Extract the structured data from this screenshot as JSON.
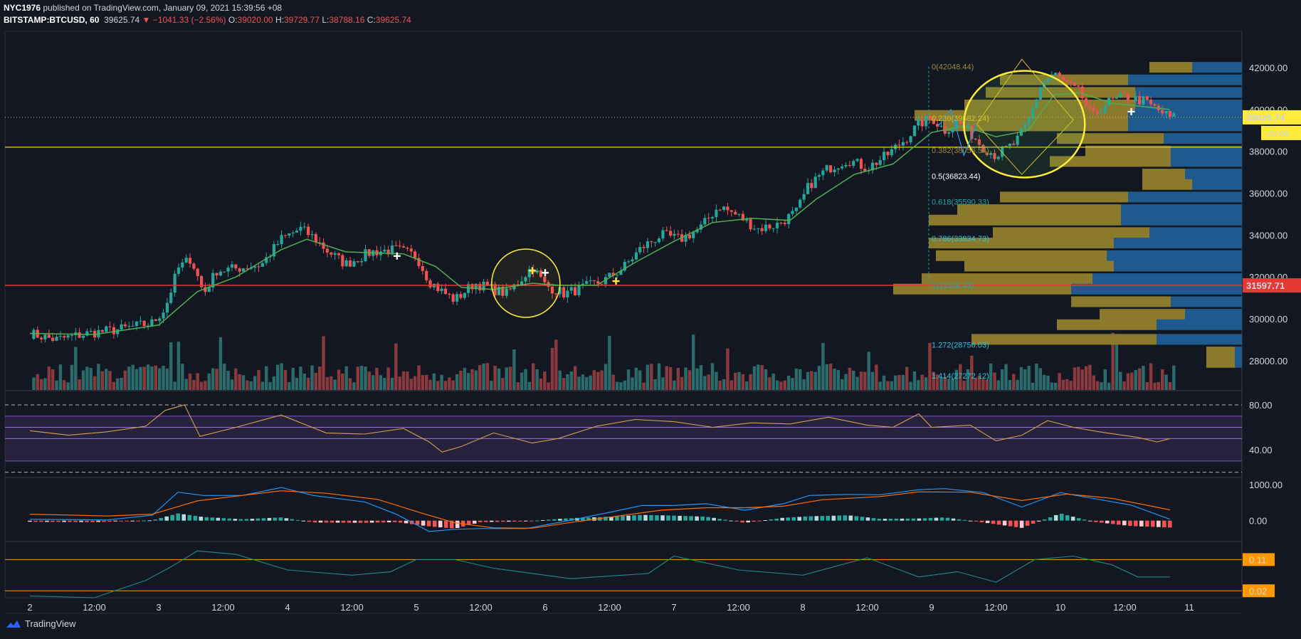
{
  "header": {
    "author": "NYC1976",
    "published_text": "published on TradingView.com, January 09, 2021 15:39:56 +08",
    "symbol": "BITSTAMP:BTCUSD, 60",
    "last_price": "39625.74",
    "change": "−1041.33 (−2.56%)",
    "open_label": "O:",
    "open": "39020.00",
    "high_label": "H:",
    "high": "39729.77",
    "low_label": "L:",
    "low": "38788.16",
    "close_label": "C:",
    "close": "39625.74"
  },
  "footer": {
    "brand": "TradingView"
  },
  "colors": {
    "background": "#131722",
    "up": "#26a69a",
    "down": "#ef5350",
    "volume_up": "#2b6b6b",
    "volume_down": "#8a3a3d",
    "ema": "#4caf50",
    "support": "#e53935",
    "resistance": "#d4c22c",
    "rsi": "#d4a04a",
    "macd": "#2196f3",
    "signal": "#ff6d00",
    "vp_left": "#8b7a2c",
    "vp_right": "#1e5a8e",
    "adx": "#1f8a8a"
  },
  "chart_data": [
    {
      "type": "candlestick",
      "symbol": "BITSTAMP:BTCUSD",
      "timeframe": "60",
      "x_tick_labels": [
        "2",
        "12:00",
        "3",
        "12:00",
        "4",
        "12:00",
        "5",
        "12:00",
        "6",
        "12:00",
        "7",
        "12:00",
        "8",
        "12:00",
        "9",
        "12:00",
        "10",
        "12:00",
        "11"
      ],
      "y_tick_labels": [
        "42000.00",
        "40000.00",
        "38000.00",
        "36000.00",
        "34000.00",
        "32000.00",
        "30000.00",
        "28000.00"
      ],
      "ylim": [
        26600,
        43600
      ],
      "close_path": [
        [
          2.0,
          29300
        ],
        [
          2.2,
          29000
        ],
        [
          2.45,
          29300
        ],
        [
          2.7,
          29500
        ],
        [
          2.95,
          29800
        ],
        [
          3.05,
          30500
        ],
        [
          3.15,
          32400
        ],
        [
          3.25,
          32900
        ],
        [
          3.35,
          31200
        ],
        [
          3.45,
          32300
        ],
        [
          3.6,
          32400
        ],
        [
          3.8,
          32600
        ],
        [
          3.95,
          33800
        ],
        [
          4.1,
          34300
        ],
        [
          4.2,
          33900
        ],
        [
          4.3,
          33300
        ],
        [
          4.45,
          32600
        ],
        [
          4.65,
          33200
        ],
        [
          4.85,
          33300
        ],
        [
          5.0,
          33000
        ],
        [
          5.1,
          31800
        ],
        [
          5.2,
          31300
        ],
        [
          5.3,
          30900
        ],
        [
          5.45,
          31700
        ],
        [
          5.6,
          31400
        ],
        [
          5.7,
          31200
        ],
        [
          5.8,
          31800
        ],
        [
          5.9,
          32500
        ],
        [
          6.0,
          31600
        ],
        [
          6.15,
          31200
        ],
        [
          6.3,
          31500
        ],
        [
          6.45,
          31800
        ],
        [
          6.6,
          32400
        ],
        [
          6.75,
          33400
        ],
        [
          6.9,
          34000
        ],
        [
          7.05,
          33800
        ],
        [
          7.2,
          34300
        ],
        [
          7.35,
          35400
        ],
        [
          7.5,
          34900
        ],
        [
          7.65,
          34300
        ],
        [
          7.8,
          34500
        ],
        [
          7.95,
          35100
        ],
        [
          8.05,
          36400
        ],
        [
          8.2,
          37200
        ],
        [
          8.35,
          37600
        ],
        [
          8.5,
          37200
        ],
        [
          8.65,
          37800
        ],
        [
          8.8,
          38600
        ],
        [
          8.9,
          39300
        ],
        [
          9.0,
          39600
        ],
        [
          9.1,
          39000
        ],
        [
          9.2,
          39400
        ],
        [
          9.3,
          38900
        ],
        [
          9.4,
          38200
        ],
        [
          9.5,
          37800
        ],
        [
          9.65,
          38400
        ],
        [
          9.75,
          39400
        ],
        [
          9.85,
          41200
        ],
        [
          9.95,
          41700
        ],
        [
          10.05,
          41200
        ],
        [
          10.15,
          40800
        ],
        [
          10.25,
          39600
        ],
        [
          10.35,
          40300
        ],
        [
          10.5,
          40600
        ],
        [
          10.65,
          40400
        ],
        [
          10.75,
          40000
        ],
        [
          10.85,
          39626
        ]
      ],
      "ema_path": [
        [
          2.0,
          29300
        ],
        [
          2.5,
          29250
        ],
        [
          3.0,
          29700
        ],
        [
          3.3,
          31300
        ],
        [
          3.6,
          32000
        ],
        [
          3.95,
          33300
        ],
        [
          4.15,
          33800
        ],
        [
          4.45,
          33200
        ],
        [
          4.9,
          33100
        ],
        [
          5.15,
          32500
        ],
        [
          5.35,
          31500
        ],
        [
          5.6,
          31400
        ],
        [
          5.9,
          31700
        ],
        [
          6.1,
          31600
        ],
        [
          6.4,
          31600
        ],
        [
          6.7,
          32700
        ],
        [
          7.0,
          33700
        ],
        [
          7.3,
          34600
        ],
        [
          7.6,
          34800
        ],
        [
          7.9,
          34700
        ],
        [
          8.1,
          35700
        ],
        [
          8.4,
          36900
        ],
        [
          8.7,
          37400
        ],
        [
          9.0,
          38900
        ],
        [
          9.25,
          39200
        ],
        [
          9.5,
          38700
        ],
        [
          9.75,
          39000
        ],
        [
          9.95,
          40700
        ],
        [
          10.15,
          40800
        ],
        [
          10.4,
          40300
        ],
        [
          10.85,
          40000
        ]
      ],
      "horizontal_lines": [
        {
          "name": "support",
          "price": 31597.71,
          "label": "31597.71",
          "color": "#e53935"
        },
        {
          "name": "resistance",
          "price": 38200,
          "color": "#d4c22c"
        },
        {
          "name": "last-price",
          "price": 39625.74,
          "label": "39625.74",
          "countdown": "20:06",
          "color": "#d4c22c"
        }
      ],
      "fib_levels": [
        {
          "ratio": "0",
          "price": 42048.44,
          "label": "0(42048.44)",
          "color": "#9a8a3c"
        },
        {
          "ratio": "0.236",
          "price": 39582.24,
          "label": "0.236(39582.24)",
          "color": "#d4c22c"
        },
        {
          "ratio": "0.382",
          "price": 38056.54,
          "label": "0.382(38056.54)",
          "color": "#9a8a3c"
        },
        {
          "ratio": "0.5",
          "price": 36823.44,
          "label": "0.5(36823.44)",
          "color": "#ffffff"
        },
        {
          "ratio": "0.618",
          "price": 35590.33,
          "label": "0.618(35590.33)",
          "color": "#26a6a6"
        },
        {
          "ratio": "0.786",
          "price": 33834.73,
          "label": "0.786(33834.73)",
          "color": "#26c6da"
        },
        {
          "ratio": "1",
          "price": 31598.43,
          "label": "1(31598.43)",
          "color": "#26a6a6"
        },
        {
          "ratio": "1.272",
          "price": 28756.03,
          "label": "1.272(28756.03)",
          "color": "#26c6da"
        },
        {
          "ratio": "1.414",
          "price": 27272.12,
          "label": "1.414(27272.12)",
          "color": "#26c6da"
        }
      ],
      "volume_profile": [
        {
          "price": 42000,
          "left": 60,
          "right": 70
        },
        {
          "price": 41400,
          "left": 180,
          "right": 160
        },
        {
          "price": 40800,
          "left": 210,
          "right": 150
        },
        {
          "price": 40200,
          "left": 240,
          "right": 150
        },
        {
          "price": 39700,
          "left": 300,
          "right": 160
        },
        {
          "price": 39200,
          "left": 260,
          "right": 160
        },
        {
          "price": 38600,
          "left": 150,
          "right": 110
        },
        {
          "price": 38000,
          "left": 120,
          "right": 100
        },
        {
          "price": 37500,
          "left": 170,
          "right": 100
        },
        {
          "price": 36900,
          "left": 60,
          "right": 80
        },
        {
          "price": 36400,
          "left": 70,
          "right": 70
        },
        {
          "price": 35800,
          "left": 180,
          "right": 160
        },
        {
          "price": 35200,
          "left": 230,
          "right": 170
        },
        {
          "price": 34700,
          "left": 270,
          "right": 170
        },
        {
          "price": 34100,
          "left": 220,
          "right": 130
        },
        {
          "price": 33600,
          "left": 260,
          "right": 180
        },
        {
          "price": 33000,
          "left": 240,
          "right": 190
        },
        {
          "price": 32500,
          "left": 210,
          "right": 180
        },
        {
          "price": 31900,
          "left": 240,
          "right": 210
        },
        {
          "price": 31400,
          "left": 250,
          "right": 240
        },
        {
          "price": 30800,
          "left": 140,
          "right": 100
        },
        {
          "price": 30200,
          "left": 120,
          "right": 80
        },
        {
          "price": 29700,
          "left": 140,
          "right": 120
        },
        {
          "price": 29000,
          "left": 260,
          "right": 120
        },
        {
          "price": 28400,
          "left": 40,
          "right": 10
        },
        {
          "price": 27900,
          "left": 40,
          "right": 10
        }
      ]
    },
    {
      "type": "line",
      "name": "RSI",
      "y_tick_labels": [
        "80.00",
        "40.00"
      ],
      "ylim": [
        16,
        92
      ],
      "bands": [
        80,
        70,
        60,
        50,
        30,
        20
      ],
      "points": [
        [
          2.0,
          57
        ],
        [
          2.3,
          53
        ],
        [
          2.6,
          56
        ],
        [
          2.9,
          61
        ],
        [
          3.05,
          75
        ],
        [
          3.2,
          80
        ],
        [
          3.32,
          52
        ],
        [
          3.6,
          60
        ],
        [
          3.95,
          71
        ],
        [
          4.3,
          55
        ],
        [
          4.6,
          54
        ],
        [
          4.9,
          59
        ],
        [
          5.1,
          47
        ],
        [
          5.2,
          38
        ],
        [
          5.35,
          43
        ],
        [
          5.6,
          55
        ],
        [
          5.9,
          46
        ],
        [
          6.1,
          50
        ],
        [
          6.4,
          61
        ],
        [
          6.7,
          67
        ],
        [
          7.0,
          65
        ],
        [
          7.3,
          60
        ],
        [
          7.6,
          64
        ],
        [
          7.9,
          63
        ],
        [
          8.2,
          69
        ],
        [
          8.5,
          62
        ],
        [
          8.7,
          60
        ],
        [
          8.9,
          72
        ],
        [
          9.0,
          60
        ],
        [
          9.3,
          62
        ],
        [
          9.5,
          48
        ],
        [
          9.7,
          53
        ],
        [
          9.9,
          66
        ],
        [
          10.1,
          60
        ],
        [
          10.3,
          56
        ],
        [
          10.6,
          51
        ],
        [
          10.75,
          47
        ],
        [
          10.85,
          50
        ]
      ]
    },
    {
      "type": "bar",
      "name": "MACD",
      "y_tick_labels": [
        "1000.00",
        "0.00"
      ],
      "ylim": [
        -560,
        1180
      ],
      "macd_line": [
        [
          2.0,
          40
        ],
        [
          2.6,
          20
        ],
        [
          2.95,
          150
        ],
        [
          3.15,
          790
        ],
        [
          3.35,
          700
        ],
        [
          3.65,
          700
        ],
        [
          3.95,
          920
        ],
        [
          4.2,
          700
        ],
        [
          4.6,
          520
        ],
        [
          4.85,
          170
        ],
        [
          5.1,
          -300
        ],
        [
          5.3,
          -240
        ],
        [
          5.5,
          -220
        ],
        [
          5.85,
          -220
        ],
        [
          6.15,
          -20
        ],
        [
          6.5,
          230
        ],
        [
          6.75,
          420
        ],
        [
          7.0,
          420
        ],
        [
          7.25,
          470
        ],
        [
          7.55,
          290
        ],
        [
          7.85,
          470
        ],
        [
          8.05,
          700
        ],
        [
          8.35,
          730
        ],
        [
          8.6,
          720
        ],
        [
          8.9,
          860
        ],
        [
          9.1,
          890
        ],
        [
          9.4,
          780
        ],
        [
          9.7,
          380
        ],
        [
          10.0,
          780
        ],
        [
          10.25,
          620
        ],
        [
          10.55,
          430
        ],
        [
          10.85,
          40
        ]
      ],
      "signal_line": [
        [
          2.0,
          180
        ],
        [
          2.6,
          130
        ],
        [
          2.95,
          180
        ],
        [
          3.3,
          550
        ],
        [
          3.6,
          680
        ],
        [
          3.95,
          830
        ],
        [
          4.3,
          760
        ],
        [
          4.7,
          590
        ],
        [
          5.05,
          200
        ],
        [
          5.3,
          -60
        ],
        [
          5.6,
          -200
        ],
        [
          5.9,
          -210
        ],
        [
          6.2,
          -50
        ],
        [
          6.55,
          120
        ],
        [
          6.9,
          290
        ],
        [
          7.25,
          360
        ],
        [
          7.55,
          360
        ],
        [
          7.85,
          400
        ],
        [
          8.15,
          580
        ],
        [
          8.6,
          670
        ],
        [
          8.9,
          800
        ],
        [
          9.3,
          790
        ],
        [
          9.7,
          560
        ],
        [
          10.05,
          740
        ],
        [
          10.4,
          620
        ],
        [
          10.85,
          300
        ]
      ],
      "histogram": [
        [
          2.0,
          -30
        ],
        [
          2.5,
          -40
        ],
        [
          2.95,
          10
        ],
        [
          3.15,
          200
        ],
        [
          3.35,
          100
        ],
        [
          3.65,
          40
        ],
        [
          3.95,
          90
        ],
        [
          4.2,
          -50
        ],
        [
          4.6,
          -60
        ],
        [
          4.85,
          -40
        ],
        [
          5.1,
          -160
        ],
        [
          5.3,
          -220
        ],
        [
          5.5,
          -40
        ],
        [
          5.85,
          -20
        ],
        [
          6.15,
          60
        ],
        [
          6.5,
          110
        ],
        [
          6.75,
          160
        ],
        [
          7.0,
          140
        ],
        [
          7.25,
          110
        ],
        [
          7.55,
          -60
        ],
        [
          7.85,
          80
        ],
        [
          8.05,
          120
        ],
        [
          8.35,
          150
        ],
        [
          8.6,
          50
        ],
        [
          8.9,
          60
        ],
        [
          9.1,
          90
        ],
        [
          9.4,
          -50
        ],
        [
          9.7,
          -200
        ],
        [
          10.0,
          200
        ],
        [
          10.25,
          -30
        ],
        [
          10.55,
          -150
        ],
        [
          10.85,
          -190
        ]
      ]
    },
    {
      "type": "line",
      "name": "ADX",
      "ylim": [
        0,
        0.16
      ],
      "levels": [
        {
          "value": 0.11,
          "label": "0.11"
        },
        {
          "value": 0.02,
          "label": "0.02"
        }
      ],
      "points": [
        [
          2.0,
          0.005
        ],
        [
          2.5,
          0.0
        ],
        [
          2.9,
          0.05
        ],
        [
          3.1,
          0.09
        ],
        [
          3.3,
          0.135
        ],
        [
          3.6,
          0.125
        ],
        [
          4.0,
          0.08
        ],
        [
          4.5,
          0.065
        ],
        [
          4.8,
          0.075
        ],
        [
          5.0,
          0.11
        ],
        [
          5.3,
          0.11
        ],
        [
          5.6,
          0.085
        ],
        [
          6.2,
          0.055
        ],
        [
          6.8,
          0.07
        ],
        [
          7.0,
          0.12
        ],
        [
          7.5,
          0.08
        ],
        [
          8.0,
          0.065
        ],
        [
          8.5,
          0.115
        ],
        [
          8.9,
          0.06
        ],
        [
          9.2,
          0.075
        ],
        [
          9.5,
          0.045
        ],
        [
          9.8,
          0.11
        ],
        [
          10.1,
          0.12
        ],
        [
          10.4,
          0.095
        ],
        [
          10.6,
          0.06
        ],
        [
          10.85,
          0.06
        ]
      ]
    }
  ]
}
